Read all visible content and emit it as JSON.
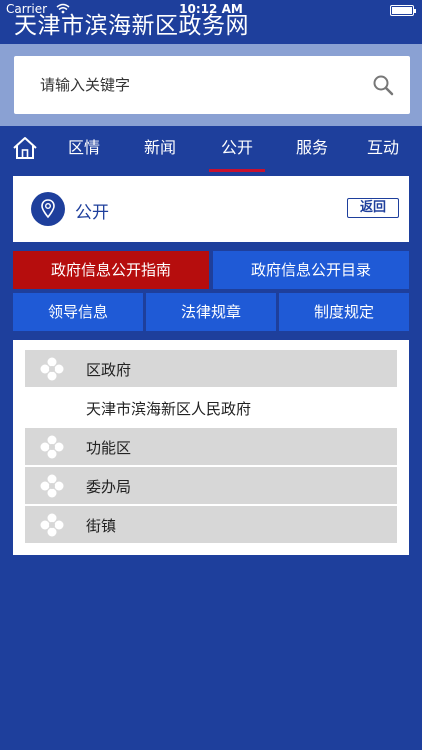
{
  "status_bar": {
    "carrier": "Carrier",
    "time": "10:12 AM",
    "wifi_icon": "wifi-icon",
    "battery_icon": "battery-icon"
  },
  "app": {
    "title": "天津市滨海新区政务网"
  },
  "search": {
    "placeholder": "请输入关键字",
    "icon": "search-icon"
  },
  "nav": {
    "home_icon": "home-icon",
    "tabs": [
      {
        "label": "区情"
      },
      {
        "label": "新闻"
      },
      {
        "label": "公开",
        "active": true
      },
      {
        "label": "服务"
      },
      {
        "label": "互动"
      }
    ],
    "active_color": "#c8102e"
  },
  "section": {
    "title": "公开",
    "icon": "location-pin-icon",
    "back_label": "返回"
  },
  "buttons": {
    "row1": [
      {
        "label": "政府信息公开指南",
        "active": true
      },
      {
        "label": "政府信息公开目录"
      }
    ],
    "row2": [
      {
        "label": "领导信息"
      },
      {
        "label": "法律规章"
      },
      {
        "label": "制度规定"
      }
    ],
    "active_color": "#b60d0d",
    "color": "#1f5ad6"
  },
  "list": {
    "items": [
      {
        "label": "区政府",
        "group": true,
        "icon": "flower-icon"
      },
      {
        "label": "天津市滨海新区人民政府",
        "group": false
      },
      {
        "label": "功能区",
        "group": true,
        "icon": "flower-icon"
      },
      {
        "label": "委办局",
        "group": true,
        "icon": "flower-icon"
      },
      {
        "label": "街镇",
        "group": true,
        "icon": "flower-icon"
      }
    ]
  },
  "colors": {
    "background": "#1e3f9c",
    "search_band": "#8aa1d3"
  }
}
